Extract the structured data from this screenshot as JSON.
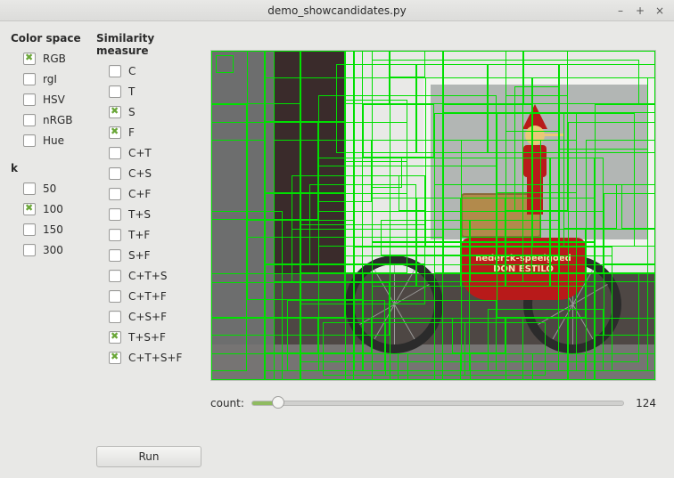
{
  "window": {
    "title": "demo_showcandidates.py"
  },
  "groups": {
    "color_space": {
      "title": "Color space",
      "items": [
        {
          "label": "RGB",
          "checked": true
        },
        {
          "label": "rgI",
          "checked": false
        },
        {
          "label": "HSV",
          "checked": false
        },
        {
          "label": "nRGB",
          "checked": false
        },
        {
          "label": "Hue",
          "checked": false
        }
      ]
    },
    "k": {
      "title": "k",
      "items": [
        {
          "label": "50",
          "checked": false
        },
        {
          "label": "100",
          "checked": true
        },
        {
          "label": "150",
          "checked": false
        },
        {
          "label": "300",
          "checked": false
        }
      ]
    },
    "similarity": {
      "title": "Similarity measure",
      "items": [
        {
          "label": "C",
          "checked": false
        },
        {
          "label": "T",
          "checked": false
        },
        {
          "label": "S",
          "checked": true
        },
        {
          "label": "F",
          "checked": true
        },
        {
          "label": "C+T",
          "checked": false
        },
        {
          "label": "C+S",
          "checked": false
        },
        {
          "label": "C+F",
          "checked": false
        },
        {
          "label": "T+S",
          "checked": false
        },
        {
          "label": "T+F",
          "checked": false
        },
        {
          "label": "S+F",
          "checked": false
        },
        {
          "label": "C+T+S",
          "checked": false
        },
        {
          "label": "C+T+F",
          "checked": false
        },
        {
          "label": "C+S+F",
          "checked": false
        },
        {
          "label": "T+S+F",
          "checked": true
        },
        {
          "label": "C+T+S+F",
          "checked": true
        }
      ]
    }
  },
  "run_label": "Run",
  "slider": {
    "label": "count:",
    "value": "124"
  },
  "scene_text": {
    "line1": "nederck-speelgoed",
    "line2": "DON ESTILO"
  },
  "boxes": [
    [
      0,
      0,
      500,
      372
    ],
    [
      0,
      0,
      260,
      372
    ],
    [
      180,
      0,
      320,
      372
    ],
    [
      0,
      0,
      150,
      300
    ],
    [
      40,
      0,
      220,
      210
    ],
    [
      70,
      0,
      100,
      280
    ],
    [
      150,
      0,
      350,
      260
    ],
    [
      240,
      30,
      258,
      190
    ],
    [
      240,
      30,
      120,
      190
    ],
    [
      360,
      30,
      140,
      190
    ],
    [
      0,
      250,
      500,
      120
    ],
    [
      60,
      240,
      440,
      130
    ],
    [
      120,
      180,
      310,
      180
    ],
    [
      160,
      220,
      290,
      140
    ],
    [
      150,
      230,
      140,
      130
    ],
    [
      280,
      230,
      170,
      130
    ],
    [
      110,
      150,
      120,
      90
    ],
    [
      120,
      160,
      100,
      60
    ],
    [
      90,
      140,
      150,
      100
    ],
    [
      200,
      100,
      120,
      120
    ],
    [
      280,
      100,
      90,
      110
    ],
    [
      340,
      40,
      50,
      140
    ],
    [
      330,
      50,
      70,
      130
    ],
    [
      320,
      70,
      90,
      90
    ],
    [
      395,
      70,
      80,
      150
    ],
    [
      390,
      110,
      100,
      140
    ],
    [
      430,
      60,
      68,
      260
    ],
    [
      0,
      180,
      80,
      190
    ],
    [
      0,
      0,
      60,
      372
    ],
    [
      60,
      0,
      40,
      372
    ],
    [
      100,
      0,
      60,
      372
    ],
    [
      0,
      80,
      120,
      110
    ],
    [
      260,
      0,
      240,
      70
    ],
    [
      260,
      0,
      140,
      70
    ],
    [
      180,
      10,
      300,
      50
    ],
    [
      5,
      5,
      20,
      20
    ],
    [
      0,
      340,
      500,
      32
    ],
    [
      70,
      340,
      430,
      32
    ],
    [
      85,
      280,
      110,
      80
    ],
    [
      200,
      280,
      120,
      80
    ],
    [
      310,
      290,
      130,
      70
    ],
    [
      150,
      100,
      30,
      30
    ],
    [
      180,
      120,
      34,
      34
    ],
    [
      210,
      140,
      30,
      40
    ],
    [
      90,
      200,
      200,
      60
    ],
    [
      290,
      200,
      200,
      60
    ],
    [
      0,
      100,
      60,
      200
    ],
    [
      0,
      60,
      40,
      300
    ],
    [
      250,
      150,
      250,
      220
    ],
    [
      70,
      250,
      430,
      120
    ],
    [
      170,
      250,
      280,
      110
    ],
    [
      100,
      250,
      380,
      100
    ],
    [
      125,
      305,
      250,
      60
    ],
    [
      195,
      305,
      90,
      60
    ],
    [
      120,
      50,
      200,
      80
    ],
    [
      320,
      200,
      100,
      100
    ],
    [
      400,
      200,
      98,
      170
    ],
    [
      420,
      100,
      78,
      260
    ],
    [
      160,
      30,
      330,
      330
    ],
    [
      60,
      30,
      330,
      330
    ],
    [
      100,
      195,
      140,
      90
    ],
    [
      40,
      190,
      120,
      90
    ],
    [
      0,
      260,
      200,
      60
    ],
    [
      200,
      30,
      150,
      230
    ],
    [
      140,
      15,
      90,
      100
    ],
    [
      230,
      15,
      80,
      100
    ],
    [
      310,
      15,
      80,
      100
    ],
    [
      390,
      15,
      110,
      100
    ],
    [
      260,
      60,
      100,
      190
    ],
    [
      260,
      120,
      60,
      130
    ],
    [
      260,
      180,
      60,
      70
    ],
    [
      320,
      120,
      60,
      130
    ],
    [
      320,
      180,
      60,
      70
    ],
    [
      380,
      120,
      60,
      130
    ],
    [
      380,
      180,
      60,
      70
    ],
    [
      190,
      190,
      100,
      40
    ],
    [
      290,
      190,
      100,
      40
    ],
    [
      120,
      120,
      60,
      50
    ],
    [
      170,
      60,
      80,
      60
    ],
    [
      70,
      250,
      100,
      110
    ],
    [
      100,
      80,
      120,
      170
    ],
    [
      400,
      80,
      100,
      170
    ],
    [
      0,
      300,
      500,
      70
    ],
    [
      100,
      300,
      300,
      70
    ],
    [
      200,
      300,
      150,
      70
    ],
    [
      60,
      0,
      90,
      80
    ],
    [
      60,
      80,
      90,
      80
    ],
    [
      60,
      160,
      90,
      80
    ],
    [
      440,
      160,
      58,
      80
    ],
    [
      440,
      240,
      58,
      80
    ],
    [
      330,
      0,
      170,
      60
    ],
    [
      150,
      55,
      70,
      70
    ],
    [
      150,
      0,
      200,
      60
    ],
    [
      350,
      0,
      148,
      60
    ],
    [
      430,
      300,
      68,
      70
    ],
    [
      180,
      165,
      50,
      50
    ],
    [
      230,
      165,
      50,
      50
    ],
    [
      280,
      165,
      50,
      50
    ],
    [
      330,
      165,
      50,
      50
    ],
    [
      380,
      165,
      50,
      50
    ],
    [
      180,
      215,
      50,
      50
    ],
    [
      230,
      215,
      50,
      50
    ],
    [
      280,
      215,
      50,
      50
    ],
    [
      330,
      215,
      50,
      50
    ],
    [
      380,
      215,
      50,
      50
    ],
    [
      150,
      100,
      260,
      260
    ],
    [
      200,
      120,
      230,
      240
    ],
    [
      70,
      100,
      90,
      160
    ],
    [
      160,
      0,
      40,
      60
    ],
    [
      200,
      0,
      40,
      30
    ],
    [
      250,
      70,
      70,
      180
    ],
    [
      330,
      90,
      60,
      160
    ],
    [
      150,
      340,
      60,
      30
    ],
    [
      220,
      340,
      60,
      30
    ],
    [
      290,
      340,
      60,
      30
    ],
    [
      360,
      340,
      60,
      30
    ],
    [
      60,
      300,
      60,
      40
    ],
    [
      120,
      300,
      60,
      40
    ],
    [
      0,
      0,
      100,
      60
    ],
    [
      330,
      300,
      100,
      70
    ],
    [
      270,
      300,
      60,
      40
    ],
    [
      395,
      150,
      60,
      50
    ],
    [
      460,
      150,
      40,
      50
    ]
  ]
}
